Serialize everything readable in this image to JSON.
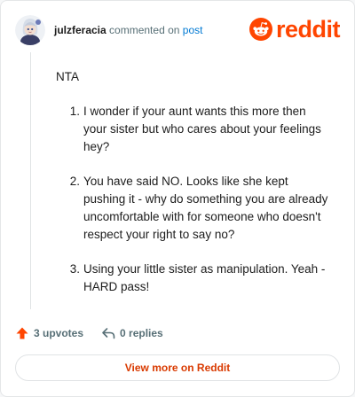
{
  "header": {
    "username": "julzferacia",
    "action": "commented on",
    "post_link": "post",
    "brand": "reddit"
  },
  "comment": {
    "opening": "NTA",
    "points": [
      {
        "number": "1.",
        "text": "I wonder if your aunt wants this more then your sister but who cares about your feelings hey?"
      },
      {
        "number": "2.",
        "text": "You have said NO. Looks like she kept pushing it - why do something you are already uncomfortable with for someone who doesn't respect your right to say no?"
      },
      {
        "number": "3.",
        "text": "Using your little sister as manipulation. Yeah - HARD pass!"
      }
    ]
  },
  "footer": {
    "upvotes": "3 upvotes",
    "replies": "0 replies"
  },
  "cta": {
    "label": "View more on Reddit"
  },
  "colors": {
    "brand": "#ff4500",
    "link": "#0079d3",
    "cta_text": "#d93a00",
    "muted": "#576f76"
  },
  "icons": [
    "avatar",
    "reddit-logo-icon",
    "upvote-arrow-icon",
    "reply-arrow-icon"
  ]
}
